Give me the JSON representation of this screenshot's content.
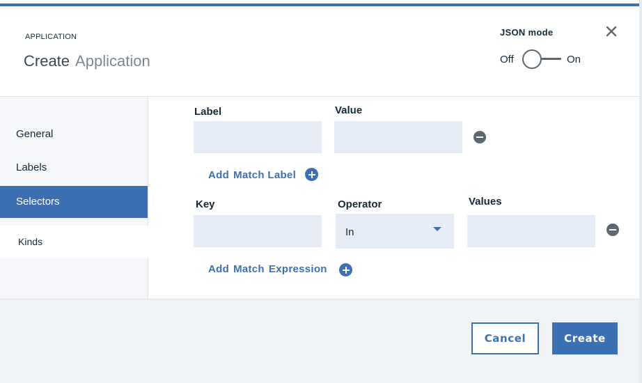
{
  "header": {
    "eyebrow": "APPLICATION",
    "title_create": "Create",
    "title_app": "Application",
    "json_mode_label": "JSON mode",
    "toggle_off": "Off",
    "toggle_on": "On",
    "toggle_state": "off",
    "close_icon": "close-icon"
  },
  "sidebar": {
    "items": [
      {
        "label": "General",
        "active": false
      },
      {
        "label": "Labels",
        "active": false
      },
      {
        "label": "Selectors",
        "active": true
      },
      {
        "label": "Kinds",
        "active": false
      }
    ]
  },
  "selectors": {
    "match_label": {
      "label_header": "Label",
      "value_header": "Value",
      "label_value": "",
      "value_value": "",
      "add_link": [
        "Add",
        "Match Label"
      ]
    },
    "match_expression": {
      "key_header": "Key",
      "operator_header": "Operator",
      "values_header": "Values",
      "key_value": "",
      "operator_value": "In",
      "values_value": "",
      "add_link": [
        "Add",
        "Match",
        "Expression"
      ]
    }
  },
  "footer": {
    "cancel_label": "Cancel",
    "create_label": "Create"
  },
  "colors": {
    "accent": "#3d70b2",
    "input_bg": "#e5ecf6",
    "sidebar_bg": "#f5f7fa",
    "footer_bg": "#f0f3f6"
  }
}
